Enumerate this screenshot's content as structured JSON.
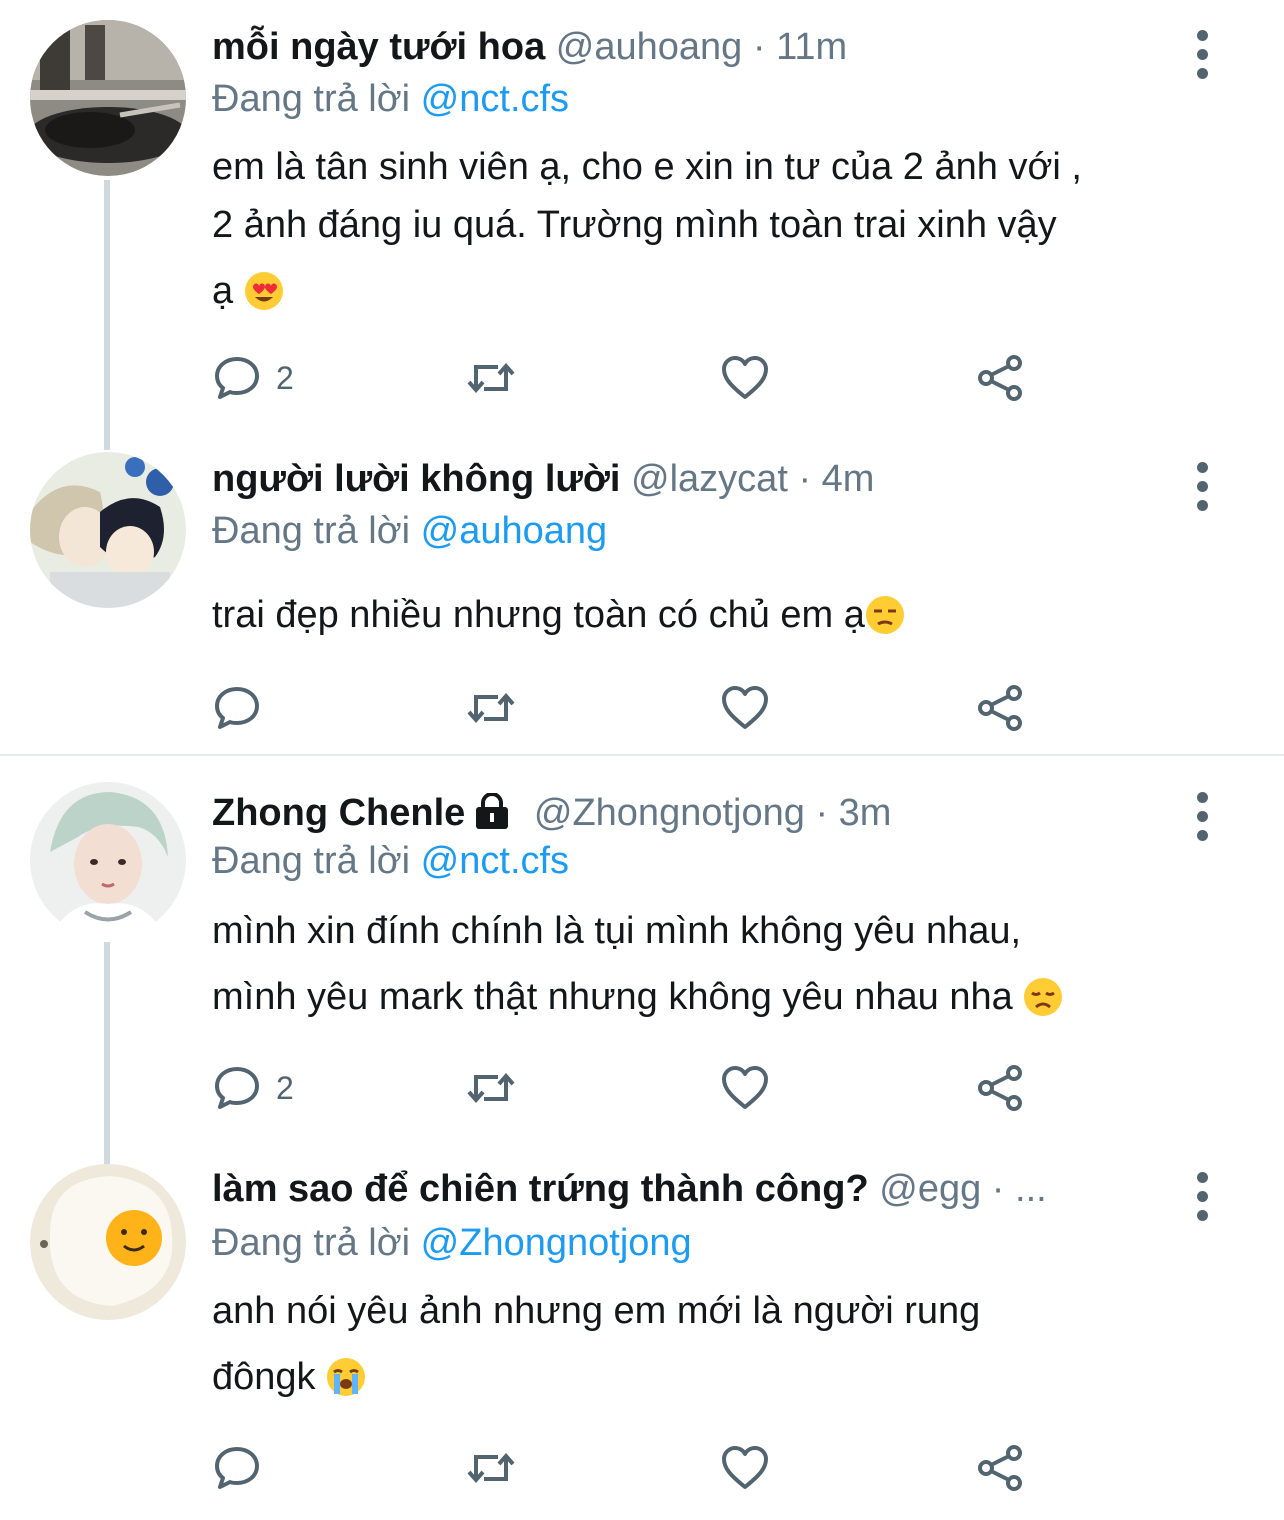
{
  "tweets": [
    {
      "name": "mỗi ngày tưới hoa",
      "handle": "@auhoang",
      "separator": "·",
      "time": "11m",
      "replying_prefix": "Đang trả lời",
      "replying_to": "@nct.cfs",
      "body_lines": [
        "em là tân sinh viên ạ, cho e xin in tư của 2 ảnh với ,",
        "2 ảnh đáng iu quá. Trường mình toàn trai xinh vậy",
        "ạ"
      ],
      "reply_count": "2",
      "emoji": "heart-eyes-emoji"
    },
    {
      "name": "người lười không lười",
      "handle": "@lazycat",
      "separator": "·",
      "time": "4m",
      "replying_prefix": "Đang trả lời",
      "replying_to": "@auhoang",
      "body_lines": [
        "trai đẹp nhiều nhưng toàn có chủ em ạ"
      ],
      "reply_count": "",
      "emoji": "unamused-emoji"
    },
    {
      "name": "Zhong Chenle",
      "handle": "@Zhongnotjong",
      "separator": "·",
      "time": "3m",
      "replying_prefix": "Đang trả lời",
      "replying_to": "@nct.cfs",
      "body_lines": [
        "mình xin đính chính là tụi mình không yêu nhau,",
        "mình yêu mark thật nhưng không yêu nhau nha"
      ],
      "reply_count": "2",
      "emoji": "disappointed-emoji"
    },
    {
      "name": "làm sao để chiên trứng thành công?",
      "handle": "@egg",
      "separator": "·",
      "time": "...",
      "replying_prefix": "Đang trả lời",
      "replying_to": "@Zhongnotjong",
      "body_lines": [
        "anh nói yêu ảnh nhưng em mới là người rung",
        "đôngk"
      ],
      "reply_count": "",
      "emoji": "crying-emoji"
    }
  ],
  "colors": {
    "accent": "#1d9bf0",
    "muted": "#657786",
    "line": "#cfd9de"
  },
  "icons": [
    "reply-icon",
    "retweet-icon",
    "like-icon",
    "share-icon",
    "more-icon",
    "lock-icon"
  ]
}
